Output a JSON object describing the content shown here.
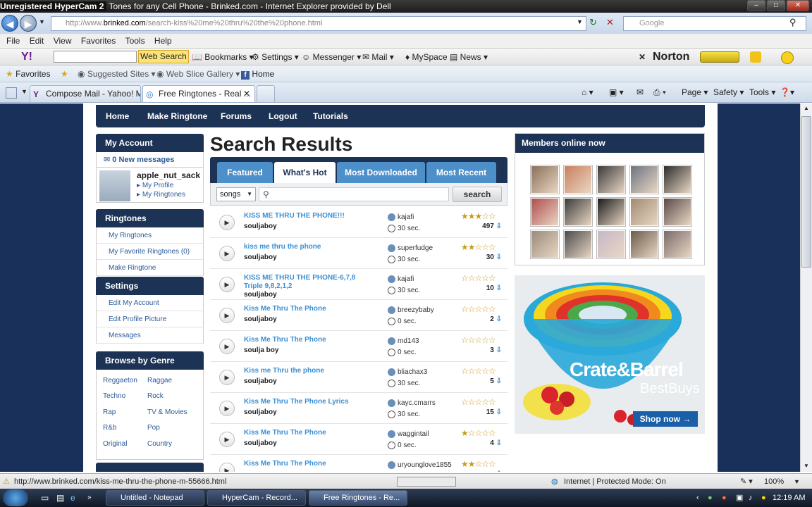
{
  "window": {
    "recorder_label": "Unregistered HyperCam 2",
    "title": "Tones for any Cell Phone - Brinked.com - Internet Explorer provided by Dell"
  },
  "address": {
    "url_prefix": "http://www.",
    "url_domain": "brinked.com",
    "url_path": "/search-kiss%20me%20thru%20the%20phone.html",
    "search_placeholder": "Google"
  },
  "menu": [
    "File",
    "Edit",
    "View",
    "Favorites",
    "Tools",
    "Help"
  ],
  "yahoo_toolbar": {
    "web_search": "Web Search",
    "items": [
      "Bookmarks",
      "Settings",
      "Messenger",
      "Mail",
      "MySpace",
      "News"
    ],
    "norton": "Norton"
  },
  "favorites_bar": {
    "favorites": "Favorites",
    "items": [
      "Suggested Sites",
      "Web Slice Gallery",
      "Home"
    ]
  },
  "tabs": [
    {
      "label": "Compose Mail - Yahoo! M..."
    },
    {
      "label": "Free Ringtones - Real ..."
    }
  ],
  "command_bar": [
    "Page",
    "Safety",
    "Tools"
  ],
  "site_nav": [
    "Home",
    "Make Ringtone",
    "Forums",
    "Logout",
    "Tutorials"
  ],
  "sidebar": {
    "account_title": "My Account",
    "new_messages": "0 New messages",
    "username": "apple_nut_sack",
    "profile_links": [
      "My Profile",
      "My Ringtones"
    ],
    "ringtones_title": "Ringtones",
    "ringtones_links": [
      "My Ringtones",
      "My Favorite Ringtones (0)",
      "Make Ringtone"
    ],
    "settings_title": "Settings",
    "settings_links": [
      "Edit My Account",
      "Edit Profile Picture",
      "Messages"
    ],
    "genre_title": "Browse by Genre",
    "genres": [
      "Reggaeton",
      "Raggae",
      "Techno",
      "Rock",
      "Rap",
      "TV & Movies",
      "R&b",
      "Pop",
      "Original",
      "Country"
    ]
  },
  "results": {
    "title": "Search Results",
    "tabs": [
      "Featured",
      "What's Hot",
      "Most Downloaded",
      "Most Recent"
    ],
    "active_tab": "What's Hot",
    "search_type": "songs",
    "search_button": "search",
    "items": [
      {
        "title": "KISS ME THRU THE PHONE!!!",
        "artist": "souljaboy",
        "user": "kajafi",
        "duration": "30 sec.",
        "rating": 3,
        "downloads": "497"
      },
      {
        "title": "kiss me thru the phone",
        "artist": "souljaboy",
        "user": "superfudge",
        "duration": "30 sec.",
        "rating": 2,
        "downloads": "30"
      },
      {
        "title": "KISS ME THRU THE PHONE-6,7,8 Triple 9,8,2,1,2",
        "artist": "souljaboy",
        "user": "kajafi",
        "duration": "30 sec.",
        "rating": 0,
        "downloads": "10"
      },
      {
        "title": "Kiss Me Thru The Phone",
        "artist": "souljaboy",
        "user": "breezybaby",
        "duration": "0 sec.",
        "rating": 0,
        "downloads": "2"
      },
      {
        "title": "Kiss Me Thru The Phone",
        "artist": "soulja boy",
        "user": "md143",
        "duration": "0 sec.",
        "rating": 0,
        "downloads": "3"
      },
      {
        "title": "Kiss me Thru the phone",
        "artist": "souljaboy",
        "user": "bliachax3",
        "duration": "30 sec.",
        "rating": 0,
        "downloads": "5"
      },
      {
        "title": "Kiss Me Thru The Phone Lyrics",
        "artist": "souljaboy",
        "user": "kayc.cmarrs",
        "duration": "30 sec.",
        "rating": 0,
        "downloads": "15"
      },
      {
        "title": "Kiss Me Thru The Phone",
        "artist": "souljaboy",
        "user": "waggintail",
        "duration": "0 sec.",
        "rating": 1,
        "downloads": "4"
      },
      {
        "title": "Kiss Me Thru The Phone",
        "artist": "",
        "user": "uryounglove1855",
        "duration": "",
        "rating": 2,
        "downloads": ""
      }
    ]
  },
  "members": {
    "title": "Members online now"
  },
  "ad": {
    "brand": "Crate&Barrel",
    "tagline": "BestBuys",
    "cta": "Shop now →"
  },
  "status": {
    "url": "http://www.brinked.com/kiss-me-thru-the-phone-m-55666.html",
    "zone": "Internet | Protected Mode: On",
    "zoom": "100%"
  },
  "taskbar": {
    "items": [
      "Untitled - Notepad",
      "HyperCam - Record...",
      "Free Ringtones - Re..."
    ],
    "time": "12:19 AM"
  }
}
